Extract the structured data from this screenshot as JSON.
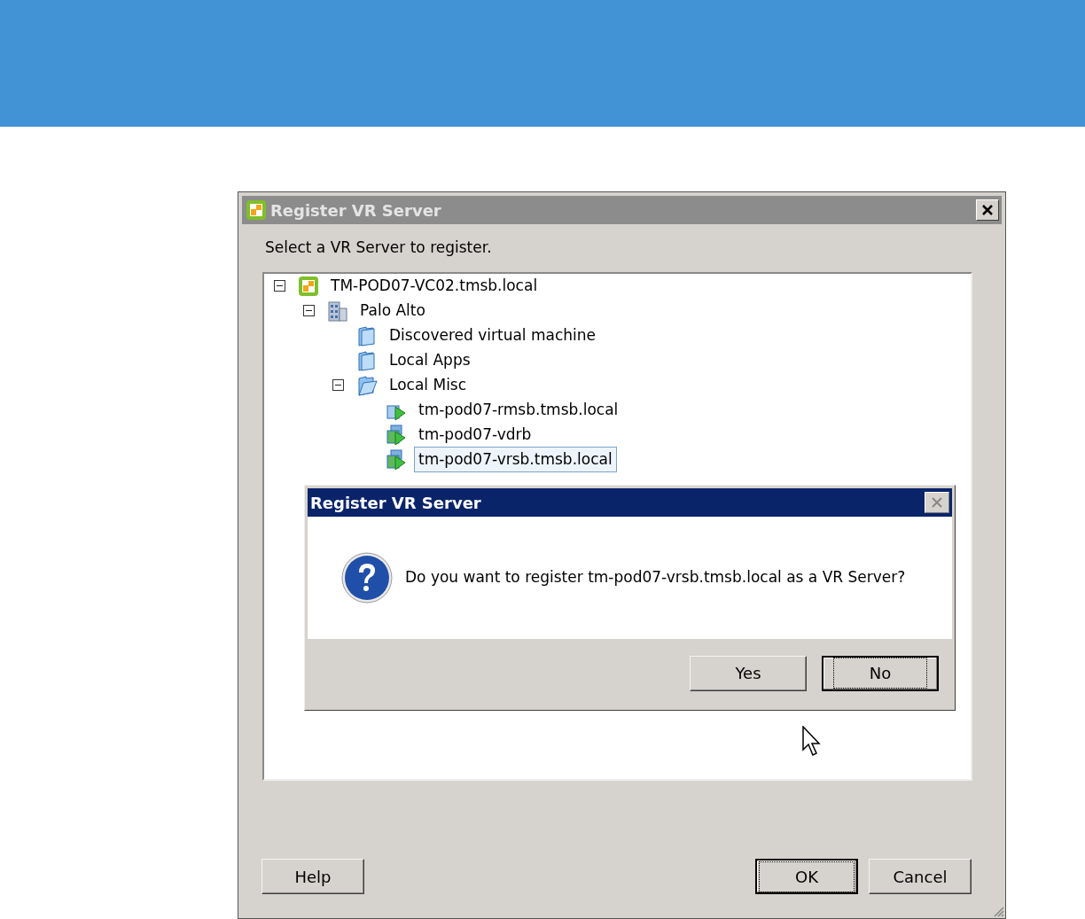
{
  "window": {
    "title": "Register VR Server"
  },
  "prompt": "Select a VR Server to register.",
  "tree": [
    {
      "label": "TM-POD07-VC02.tmsb.local",
      "kind": "vcenter",
      "expanded": true,
      "selected": false,
      "children": [
        {
          "label": "Palo Alto",
          "kind": "datacenter",
          "expanded": true,
          "selected": false,
          "children": [
            {
              "label": "Discovered virtual machine",
              "kind": "folder",
              "selected": false
            },
            {
              "label": "Local Apps",
              "kind": "folder",
              "selected": false
            },
            {
              "label": "Local Misc",
              "kind": "folder",
              "expanded": true,
              "selected": false,
              "children": [
                {
                  "label": "tm-pod07-rmsb.tmsb.local",
                  "kind": "vm-single",
                  "selected": false
                },
                {
                  "label": "tm-pod07-vdrb",
                  "kind": "vm",
                  "selected": false
                },
                {
                  "label": "tm-pod07-vrsb.tmsb.local",
                  "kind": "vm",
                  "selected": true
                }
              ]
            }
          ]
        }
      ]
    }
  ],
  "confirm": {
    "title": "Register VR Server",
    "message": "Do you want to register tm-pod07-vrsb.tmsb.local as a VR Server?",
    "buttons": [
      {
        "label": "Yes",
        "default": false
      },
      {
        "label": "No",
        "default": true
      }
    ]
  },
  "buttons": [
    {
      "label": "Help",
      "default": false
    },
    {
      "label": "OK",
      "default": true
    },
    {
      "label": "Cancel",
      "default": false
    }
  ]
}
